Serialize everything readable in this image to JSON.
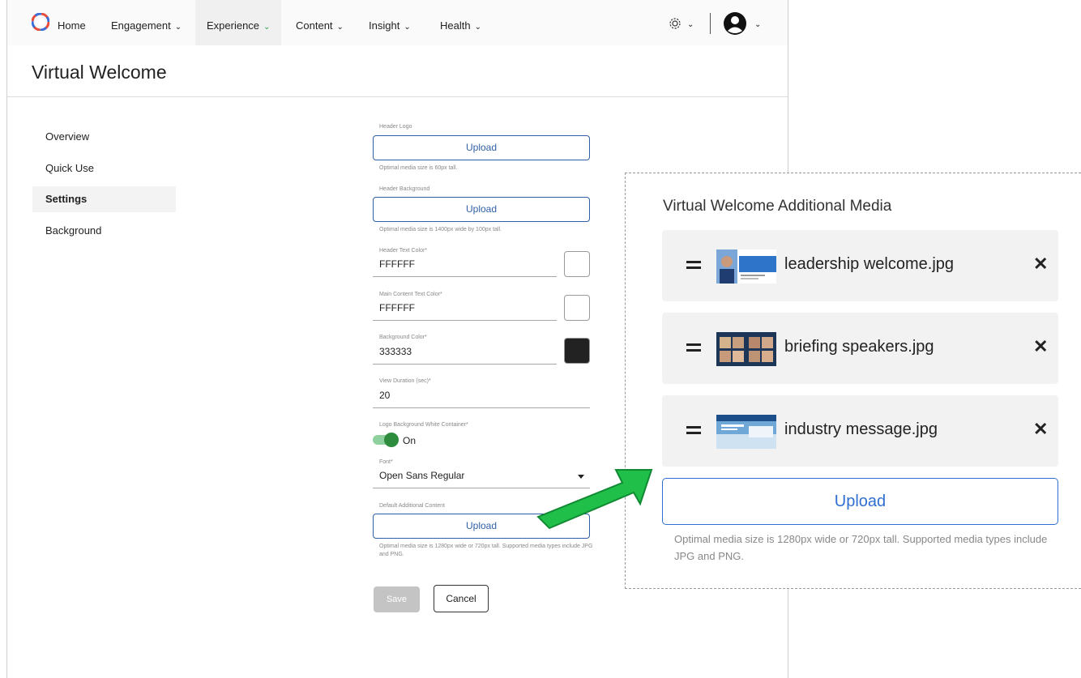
{
  "nav": {
    "items": [
      {
        "label": "Home"
      },
      {
        "label": "Engagement"
      },
      {
        "label": "Experience"
      },
      {
        "label": "Content"
      },
      {
        "label": "Insight"
      },
      {
        "label": "Health"
      }
    ],
    "active": "Experience",
    "accent_color": "#2e9e48"
  },
  "page": {
    "title": "Virtual Welcome"
  },
  "sidebar": {
    "items": [
      {
        "label": "Overview"
      },
      {
        "label": "Quick Use"
      },
      {
        "label": "Settings"
      },
      {
        "label": "Background"
      }
    ],
    "active": "Settings"
  },
  "form": {
    "header_logo": {
      "label": "Header Logo",
      "button": "Upload",
      "hint": "Optimal media size is 60px tall."
    },
    "header_background": {
      "label": "Header Background",
      "button": "Upload",
      "hint": "Optimal media size is 1400px wide by 100px tall."
    },
    "header_text_color": {
      "label": "Header Text Color*",
      "value": "FFFFFF",
      "swatch": "#FFFFFF"
    },
    "main_content_text_color": {
      "label": "Main Content Text Color*",
      "value": "FFFFFF",
      "swatch": "#FFFFFF"
    },
    "background_color": {
      "label": "Background Color*",
      "value": "333333",
      "swatch": "#222222"
    },
    "view_duration": {
      "label": "View Duration (sec)*",
      "value": "20"
    },
    "logo_background": {
      "label": "Logo Background White Container*",
      "state": "On"
    },
    "font": {
      "label": "Font*",
      "value": "Open Sans Regular"
    },
    "default_additional": {
      "label": "Default Additional Content",
      "button": "Upload",
      "hint": "Optimal media size is 1280px wide or 720px tall. Supported media types include JPG and PNG."
    },
    "save": "Save",
    "cancel": "Cancel"
  },
  "overlay": {
    "title": "Virtual Welcome Additional Media",
    "items": [
      {
        "name": "leadership welcome.jpg"
      },
      {
        "name": "briefing speakers.jpg"
      },
      {
        "name": "industry message.jpg"
      }
    ],
    "upload": "Upload",
    "hint": "Optimal media size is 1280px wide or 720px tall. Supported media types include JPG and PNG."
  },
  "colors": {
    "primary_blue": "#2f5fa6",
    "toggle_green": "#2e8c3f",
    "arrow_green": "#1fbf4a"
  }
}
